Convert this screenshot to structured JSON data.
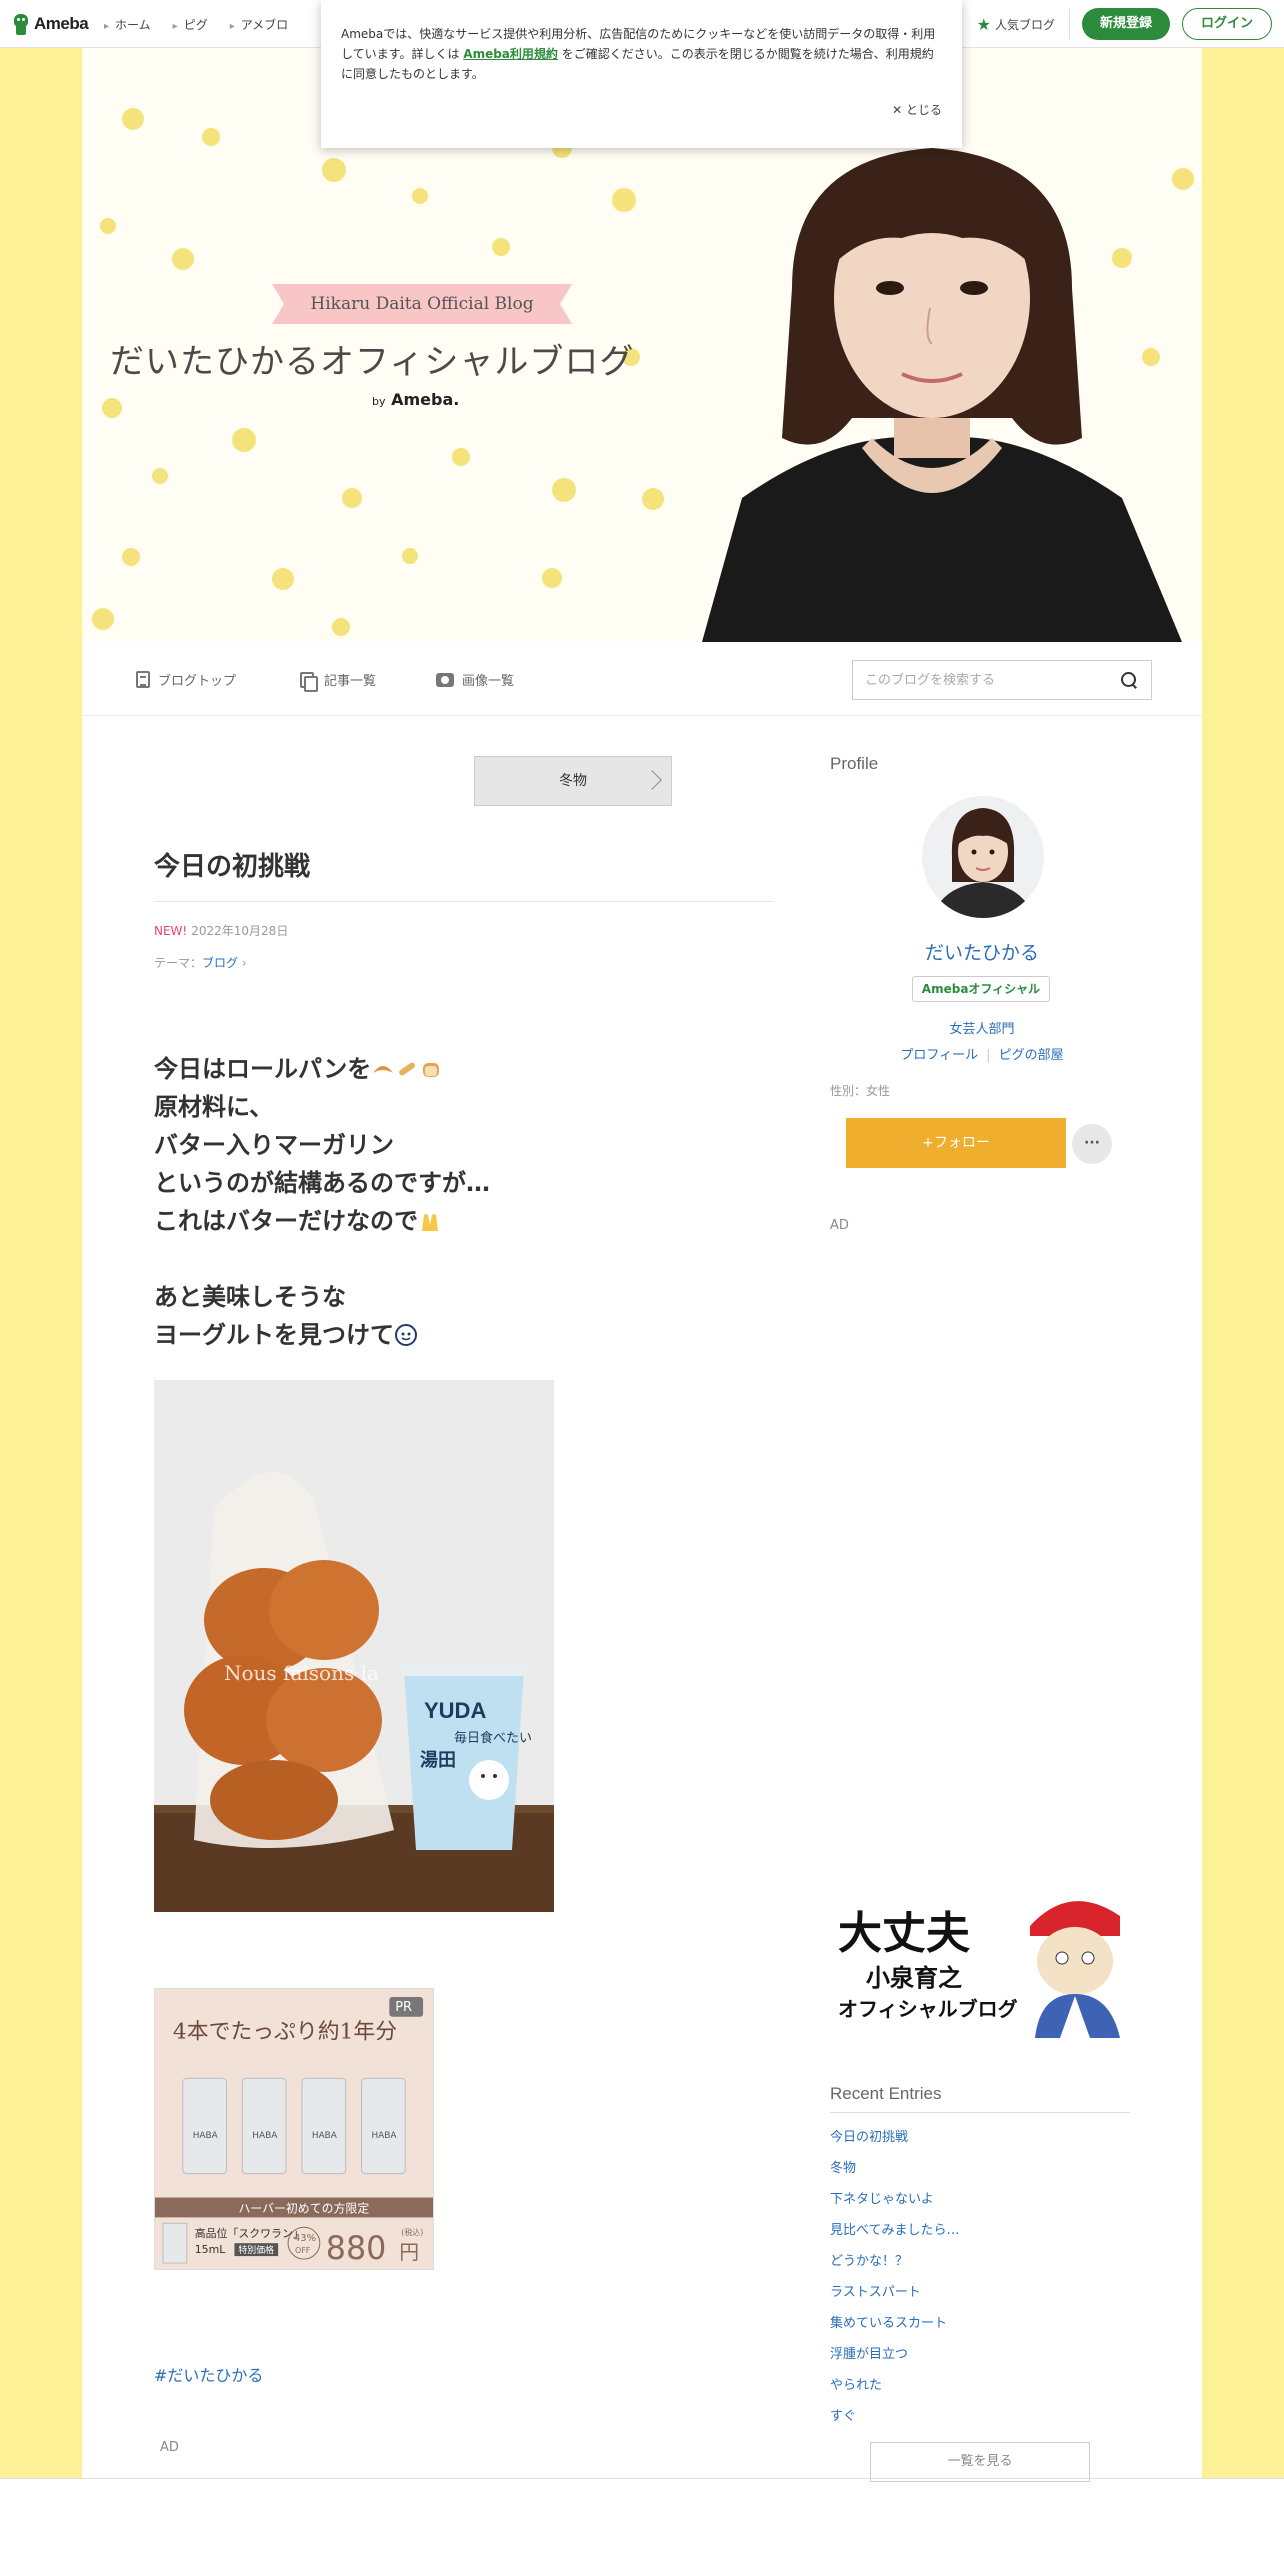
{
  "nav": {
    "logo": "Ameba",
    "links": [
      "ホーム",
      "ピグ",
      "アメブロ"
    ],
    "popular": "人気ブログ",
    "register": "新規登録",
    "login": "ログイン"
  },
  "cookie": {
    "text_before": "Amebaでは、快適なサービス提供や利用分析、広告配信のためにクッキーなどを使い訪問データの取得・利用しています。詳しくは",
    "link": "Ameba利用規約",
    "text_after": "をご確認ください。この表示を閉じるか閲覧を続けた場合、利用規約に同意したものとします。",
    "close": "✕ とじる"
  },
  "header": {
    "ribbon": "Hikaru Daita Official Blog",
    "title": "だいたひかるオフィシャルブログ",
    "by": "by",
    "ameba": "Ameba."
  },
  "subnav": {
    "top": "ブログトップ",
    "list": "記事一覧",
    "images": "画像一覧",
    "search_placeholder": "このブログを検索する"
  },
  "article": {
    "prev_label": "冬物",
    "title": "今日の初挑戦",
    "new_badge": "NEW!",
    "date": "2022年10月28日",
    "theme_label": "テーマ：",
    "theme": "ブログ",
    "lines": [
      "今日はロールパンを",
      "原材料に、",
      "バター入りマーガリン",
      "というのが結構あるのですが…",
      "これはバターだけなので",
      "あと美味しそうな",
      "ヨーグルトを見つけて"
    ],
    "hashtag": "#だいたひかる",
    "ad_label": "AD"
  },
  "photo": {
    "cup_brand": "YUDA",
    "cup_text1": "毎日食べたい",
    "cup_text2": "湯田",
    "bag_text": "Nous faisons la"
  },
  "ad": {
    "pr": "PR",
    "headline": "4本でたっぷり約1年分",
    "bottle_label": "HABA",
    "offer": "ハーバー初めての方限定",
    "product": "高品位「スクワラン」",
    "size": "15mL",
    "special": "特別価格",
    "discount": "43%",
    "off": "OFF",
    "price": "880",
    "yen": "円",
    "tax": "(税込)"
  },
  "sidebar": {
    "profile_heading": "Profile",
    "name": "だいたひかる",
    "badge": "Amebaオフィシャル",
    "category": "女芸人部門",
    "profile_link": "プロフィール",
    "pig_link": "ピグの部屋",
    "gender": "性別：女性",
    "follow": "+フォロー",
    "more": "···",
    "ad_label": "AD",
    "banner_line1": "大丈夫",
    "banner_line2": "小泉育之",
    "banner_line3": "オフィシャルブログ",
    "recent_heading": "Recent Entries",
    "recent": [
      "今日の初挑戦",
      "冬物",
      "下ネタじゃないよ",
      "見比べてみましたら…",
      "どうかな！？",
      "ラストスパート",
      "集めているスカート",
      "浮腫が目立つ",
      "やられた",
      "すぐ"
    ],
    "see_all": "一覧を見る"
  },
  "colors": {
    "accent_green": "#2d8c3c",
    "follow_orange": "#f0ae2f",
    "link_blue": "#2a6ebb",
    "band_yellow": "#fdf198"
  }
}
